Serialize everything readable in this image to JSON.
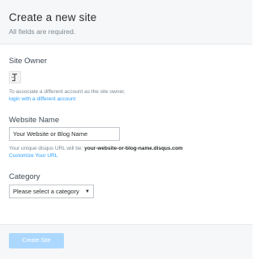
{
  "header": {
    "title": "Create a new site",
    "subtitle": "All fields are required."
  },
  "site_owner": {
    "label": "Site Owner",
    "avatar_icon": "user-avatar-icon",
    "hint": "To associate a different account as the site owner,",
    "link": "login with a different account"
  },
  "website_name": {
    "label": "Website Name",
    "value": "Your Website or Blog Name",
    "hint_prefix": "Your unique disqus URL will be:",
    "hint_url": "your-website-or-blog-name.disqus.com",
    "customize_link": "Customize Your URL"
  },
  "category": {
    "label": "Category",
    "selected": "Please select a category",
    "caret_icon": "triangle-down-icon"
  },
  "footer": {
    "create_label": "Create Site",
    "create_color": "#acd8ff"
  }
}
